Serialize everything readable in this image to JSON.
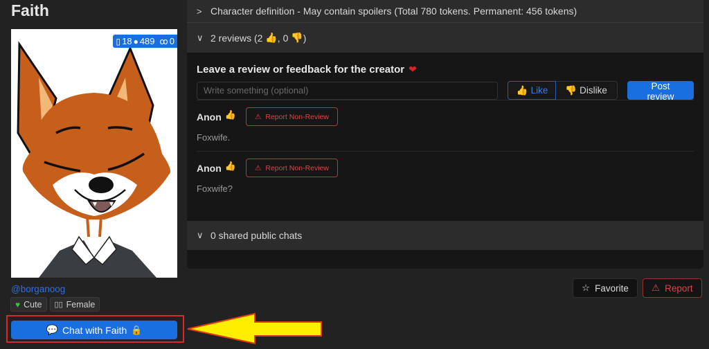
{
  "character": {
    "name": "Faith",
    "creator": "@borganoog",
    "stats": {
      "tokens_icon": "document-icon",
      "tokens": "18",
      "chats_icon": "chat-bubbles-icon",
      "chats": "489",
      "users_icon": "users-icon",
      "users": "0"
    },
    "tags": [
      {
        "icon": "green-heart-icon",
        "label": "Cute"
      },
      {
        "icon": "missing-glyph-icon",
        "glyph": "▯▯",
        "label": "Female"
      }
    ],
    "chat_button": {
      "label": "Chat with Faith",
      "icon": "chat-bubbles-icon",
      "lock_icon": "lock-icon"
    }
  },
  "panel": {
    "definition_header": "Character definition - May contain spoilers (Total 780 tokens. Permanent: 456 tokens)",
    "reviews_header": {
      "prefix": "2 reviews (2",
      "middle": ", 0",
      "suffix": ")"
    },
    "review_form": {
      "title": "Leave a review or feedback for the creator",
      "placeholder": "Write something (optional)",
      "value": "",
      "like_label": "Like",
      "dislike_label": "Dislike",
      "post_label": "Post review"
    },
    "reviews": [
      {
        "author": "Anon",
        "vote": "like",
        "report_label": "Report Non-Review",
        "text": "Foxwife."
      },
      {
        "author": "Anon",
        "vote": "like",
        "report_label": "Report Non-Review",
        "text": "Foxwife?"
      }
    ],
    "shared_chats_header": "0 shared public chats"
  },
  "actions": {
    "favorite_label": "Favorite",
    "report_label": "Report"
  },
  "annotation": {
    "highlight_color": "#d42a2a",
    "arrow_color": "#ffee00"
  },
  "colors": {
    "accent": "#1a6fe0",
    "like": "#2ebf5a",
    "dislike": "#e0443a",
    "danger": "#d9454a"
  }
}
